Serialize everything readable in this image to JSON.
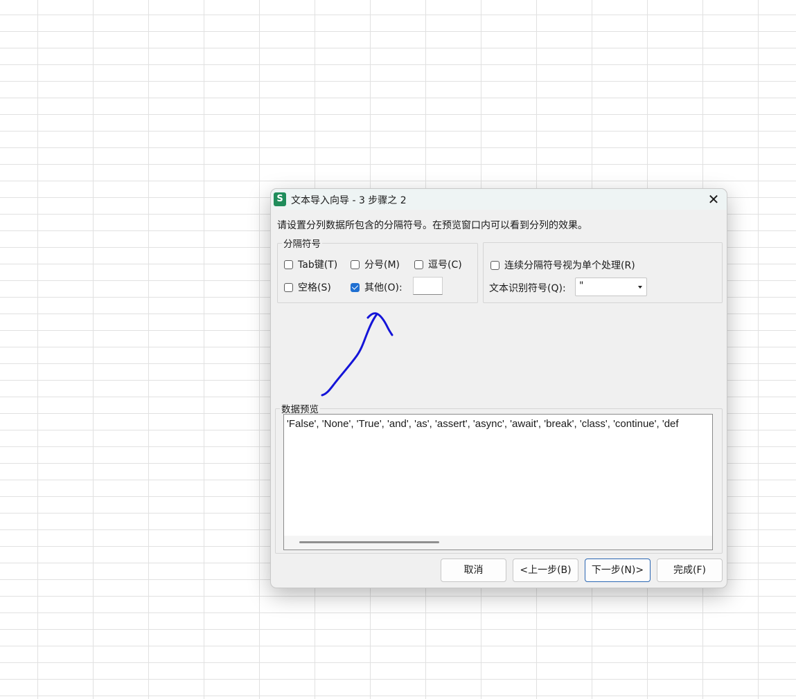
{
  "dialog": {
    "title": "文本导入向导 - 3 步骤之 2",
    "app_icon_letter": "S",
    "close_symbol": "✕",
    "instruction": "请设置分列数据所包含的分隔符号。在预览窗口内可以看到分列的效果。"
  },
  "delimiters": {
    "legend": "分隔符号",
    "tab": {
      "label": "Tab键(T)",
      "checked": false
    },
    "semicolon": {
      "label": "分号(M)",
      "checked": false
    },
    "comma": {
      "label": "逗号(C)",
      "checked": false
    },
    "space": {
      "label": "空格(S)",
      "checked": false
    },
    "other": {
      "label": "其他(O):",
      "checked": true,
      "value": ""
    }
  },
  "options": {
    "consecutive": {
      "label": "连续分隔符号视为单个处理(R)",
      "checked": false
    },
    "text_qualifier_label": "文本识别符号(Q):",
    "text_qualifier_value": "\""
  },
  "preview": {
    "legend": "数据预览",
    "line": "'False', 'None', 'True', 'and', 'as', 'assert', 'async', 'await', 'break', 'class', 'continue', 'def"
  },
  "buttons": {
    "cancel": "取消",
    "back": "<上一步(B)",
    "next": "下一步(N)>",
    "finish": "完成(F)"
  },
  "colors": {
    "accent": "#1f6fd1",
    "annotation_stroke": "#1414d8",
    "app_icon": "#1f8d5b"
  }
}
